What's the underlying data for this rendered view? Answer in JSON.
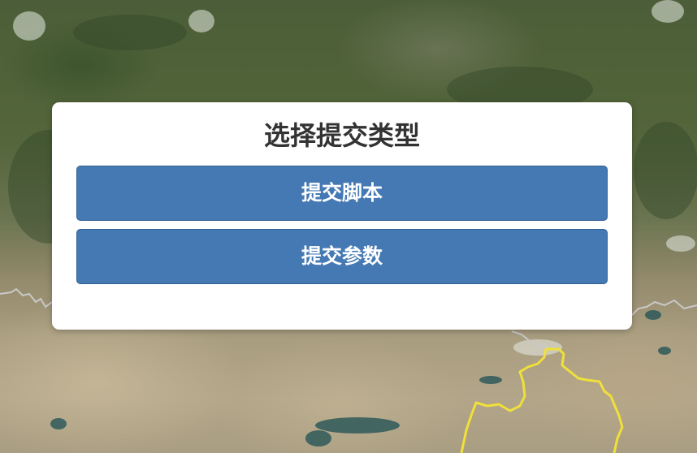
{
  "dialog": {
    "title": "选择提交类型",
    "buttons": {
      "submit_script": "提交脚本",
      "submit_params": "提交参数"
    }
  },
  "colors": {
    "button_primary": "#4479b4",
    "button_border": "#335f91",
    "dialog_bg": "#ffffff",
    "title_text": "#333333",
    "boundary_line": "#f0e03a",
    "border_line": "#c8c8c8"
  }
}
